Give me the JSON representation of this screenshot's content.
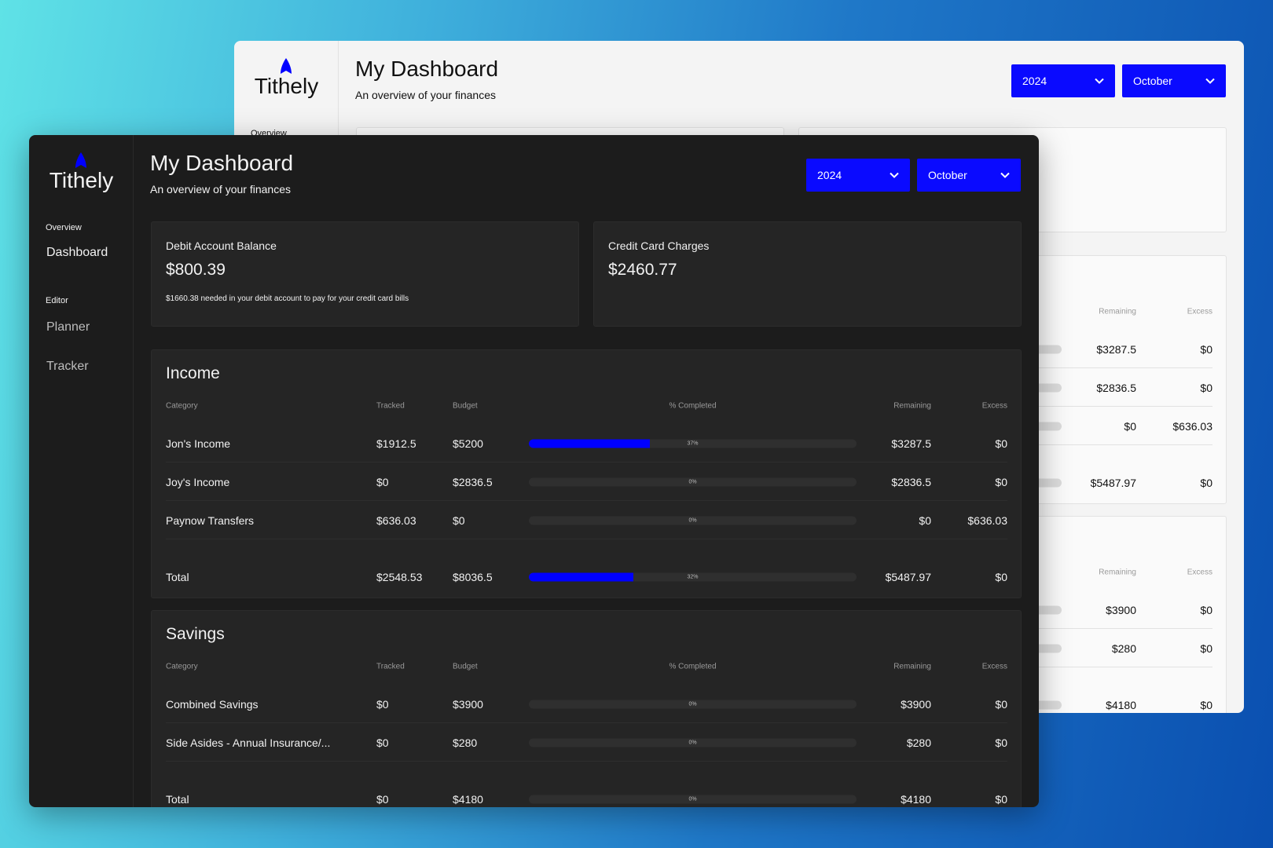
{
  "app": {
    "name": "Tithely",
    "accent": "#0000ff"
  },
  "sidebar": {
    "section_overview": "Overview",
    "dashboard": "Dashboard",
    "section_editor": "Editor",
    "planner": "Planner",
    "tracker": "Tracker"
  },
  "header": {
    "title": "My Dashboard",
    "subtitle": "An overview of your finances",
    "year": "2024",
    "month": "October"
  },
  "cards": {
    "debit": {
      "label": "Debit Account Balance",
      "value": "$800.39",
      "note": "$1660.38 needed in your debit account to pay for your credit card bills"
    },
    "credit": {
      "label": "Credit Card Charges",
      "value": "$2460.77"
    }
  },
  "columns": {
    "category": "Category",
    "tracked": "Tracked",
    "budget": "Budget",
    "completed": "% Completed",
    "remaining": "Remaining",
    "excess": "Excess"
  },
  "income": {
    "title": "Income",
    "rows": [
      {
        "category": "Jon's Income",
        "tracked": "$1912.5",
        "budget": "$5200",
        "percent": 37,
        "percent_label": "37%",
        "remaining": "$3287.5",
        "excess": "$0"
      },
      {
        "category": "Joy's Income",
        "tracked": "$0",
        "budget": "$2836.5",
        "percent": 0,
        "percent_label": "0%",
        "remaining": "$2836.5",
        "excess": "$0"
      },
      {
        "category": "Paynow Transfers",
        "tracked": "$636.03",
        "budget": "$0",
        "percent": 0,
        "percent_label": "0%",
        "remaining": "$0",
        "excess": "$636.03"
      }
    ],
    "total": {
      "category": "Total",
      "tracked": "$2548.53",
      "budget": "$8036.5",
      "percent": 32,
      "percent_label": "32%",
      "remaining": "$5487.97",
      "excess": "$0"
    }
  },
  "savings": {
    "title": "Savings",
    "rows": [
      {
        "category": "Combined Savings",
        "tracked": "$0",
        "budget": "$3900",
        "percent": 0,
        "percent_label": "0%",
        "remaining": "$3900",
        "excess": "$0"
      },
      {
        "category": "Side Asides - Annual Insurance/...",
        "tracked": "$0",
        "budget": "$280",
        "percent": 0,
        "percent_label": "0%",
        "remaining": "$280",
        "excess": "$0"
      }
    ],
    "total": {
      "category": "Total",
      "tracked": "$0",
      "budget": "$4180",
      "percent": 0,
      "percent_label": "0%",
      "remaining": "$4180",
      "excess": "$0"
    }
  }
}
